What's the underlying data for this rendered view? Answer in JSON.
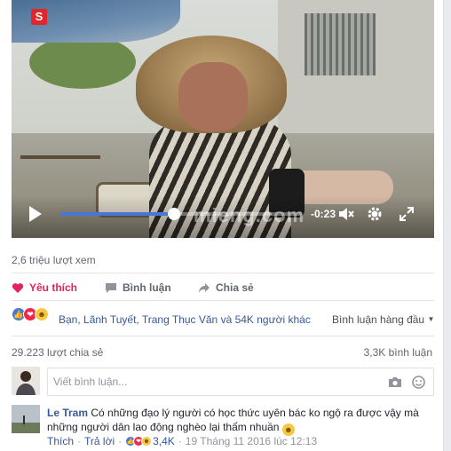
{
  "video": {
    "logo_letter": "S",
    "watermark": "mieng.com",
    "time_remaining": "-0:23",
    "progress_fraction": 0.47
  },
  "stats": {
    "views": "2,6 triệu lượt xem"
  },
  "actions": {
    "like": "Yêu thích",
    "comment": "Bình luận",
    "share": "Chia sẻ"
  },
  "reactions": {
    "summary": "Bạn, Lãnh Tuyết, Trang Thục Văn và 54K người khác",
    "sort_label": "Bình luận hàng đầu"
  },
  "counts": {
    "shares": "29.223 lượt chia sẻ",
    "comments": "3,3K bình luận"
  },
  "composer": {
    "placeholder": "Viết bình luận..."
  },
  "comment": {
    "author": "Le Tram",
    "text": "Có những đạo lý người có học thức uyên bác ko ngộ ra được vậy mà những người dân lao động nghèo lại thấm nhuần",
    "like_label": "Thích",
    "reply_label": "Trả lời",
    "reaction_count": "3,4K",
    "timestamp": "19 Tháng 11 2016 lúc 12:13"
  },
  "colors": {
    "link": "#365899",
    "liked": "#e0245e",
    "progress": "#4a76d6"
  }
}
